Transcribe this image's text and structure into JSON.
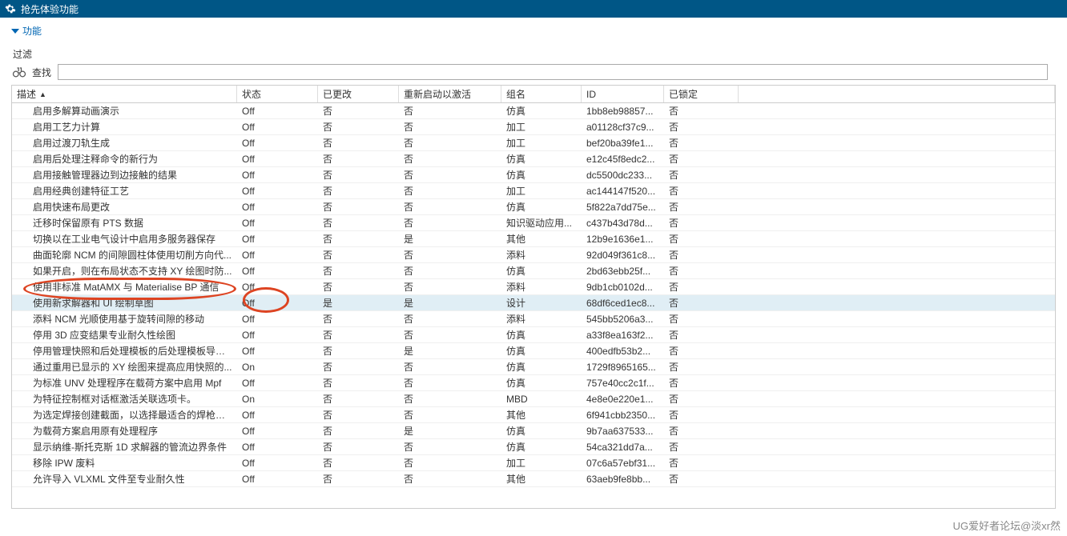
{
  "titlebar": {
    "title": "抢先体验功能"
  },
  "section": {
    "label": "功能"
  },
  "filter": {
    "label": "过滤"
  },
  "search": {
    "label": "查找",
    "value": ""
  },
  "columns": {
    "desc": "描述",
    "state": "状态",
    "changed": "已更改",
    "restart": "重新启动以激活",
    "group": "组名",
    "id": "ID",
    "locked": "已锁定"
  },
  "rows": [
    {
      "desc": "启用多解算动画演示",
      "state": "Off",
      "changed": "否",
      "restart": "否",
      "group": "仿真",
      "id": "1bb8eb98857...",
      "locked": "否",
      "hl": false
    },
    {
      "desc": "启用工艺力计算",
      "state": "Off",
      "changed": "否",
      "restart": "否",
      "group": "加工",
      "id": "a01128cf37c9...",
      "locked": "否",
      "hl": false
    },
    {
      "desc": "启用过渡刀轨生成",
      "state": "Off",
      "changed": "否",
      "restart": "否",
      "group": "加工",
      "id": "bef20ba39fe1...",
      "locked": "否",
      "hl": false
    },
    {
      "desc": "启用后处理注释命令的新行为",
      "state": "Off",
      "changed": "否",
      "restart": "否",
      "group": "仿真",
      "id": "e12c45f8edc2...",
      "locked": "否",
      "hl": false
    },
    {
      "desc": "启用接触管理器边到边接触的结果",
      "state": "Off",
      "changed": "否",
      "restart": "否",
      "group": "仿真",
      "id": "dc5500dc233...",
      "locked": "否",
      "hl": false
    },
    {
      "desc": "启用经典创建特征工艺",
      "state": "Off",
      "changed": "否",
      "restart": "否",
      "group": "加工",
      "id": "ac144147f520...",
      "locked": "否",
      "hl": false
    },
    {
      "desc": "启用快速布局更改",
      "state": "Off",
      "changed": "否",
      "restart": "否",
      "group": "仿真",
      "id": "5f822a7dd75e...",
      "locked": "否",
      "hl": false
    },
    {
      "desc": "迁移时保留原有 PTS 数据",
      "state": "Off",
      "changed": "否",
      "restart": "否",
      "group": "知识驱动应用...",
      "id": "c437b43d78d...",
      "locked": "否",
      "hl": false
    },
    {
      "desc": "切换以在工业电气设计中启用多服务器保存",
      "state": "Off",
      "changed": "否",
      "restart": "是",
      "group": "其他",
      "id": "12b9e1636e1...",
      "locked": "否",
      "hl": false
    },
    {
      "desc": "曲面轮廓 NCM 的间隙圆柱体使用切削方向代...",
      "state": "Off",
      "changed": "否",
      "restart": "否",
      "group": "添料",
      "id": "92d049f361c8...",
      "locked": "否",
      "hl": false
    },
    {
      "desc": "如果开启，则在布局状态不支持 XY 绘图时防...",
      "state": "Off",
      "changed": "否",
      "restart": "否",
      "group": "仿真",
      "id": "2bd63ebb25f...",
      "locked": "否",
      "hl": false
    },
    {
      "desc": "使用非标准 MatAMX 与 Materialise BP 通信",
      "state": "Off",
      "changed": "否",
      "restart": "否",
      "group": "添料",
      "id": "9db1cb0102d...",
      "locked": "否",
      "hl": false
    },
    {
      "desc": "使用新求解器和 UI 绘制草图",
      "state": "Off",
      "changed": "是",
      "restart": "是",
      "group": "设计",
      "id": "68df6ced1ec8...",
      "locked": "否",
      "hl": true
    },
    {
      "desc": "添料 NCM 光顺使用基于旋转间隙的移动",
      "state": "Off",
      "changed": "否",
      "restart": "否",
      "group": "添料",
      "id": "545bb5206a3...",
      "locked": "否",
      "hl": false
    },
    {
      "desc": "停用 3D 应变结果专业耐久性绘图",
      "state": "Off",
      "changed": "否",
      "restart": "否",
      "group": "仿真",
      "id": "a33f8ea163f2...",
      "locked": "否",
      "hl": false
    },
    {
      "desc": "停用管理快照和后处理模板的后处理模板导航器",
      "state": "Off",
      "changed": "否",
      "restart": "是",
      "group": "仿真",
      "id": "400edfb53b2...",
      "locked": "否",
      "hl": false
    },
    {
      "desc": "通过重用已显示的 XY 绘图来提高应用快照的...",
      "state": "On",
      "changed": "否",
      "restart": "否",
      "group": "仿真",
      "id": "1729f8965165...",
      "locked": "否",
      "hl": false
    },
    {
      "desc": "为标准 UNV 处理程序在载荷方案中启用 Mpf",
      "state": "Off",
      "changed": "否",
      "restart": "否",
      "group": "仿真",
      "id": "757e40cc2c1f...",
      "locked": "否",
      "hl": false
    },
    {
      "desc": "为特征控制框对话框激活关联选项卡。",
      "state": "On",
      "changed": "否",
      "restart": "否",
      "group": "MBD",
      "id": "4e8e0e220e1...",
      "locked": "否",
      "hl": false
    },
    {
      "desc": "为选定焊接创建截面，以选择最适合的焊枪并...",
      "state": "Off",
      "changed": "否",
      "restart": "否",
      "group": "其他",
      "id": "6f941cbb2350...",
      "locked": "否",
      "hl": false
    },
    {
      "desc": "为载荷方案启用原有处理程序",
      "state": "Off",
      "changed": "否",
      "restart": "是",
      "group": "仿真",
      "id": "9b7aa637533...",
      "locked": "否",
      "hl": false
    },
    {
      "desc": "显示纳维-斯托克斯 1D 求解器的管流边界条件",
      "state": "Off",
      "changed": "否",
      "restart": "否",
      "group": "仿真",
      "id": "54ca321dd7a...",
      "locked": "否",
      "hl": false
    },
    {
      "desc": "移除 IPW 废料",
      "state": "Off",
      "changed": "否",
      "restart": "否",
      "group": "加工",
      "id": "07c6a57ebf31...",
      "locked": "否",
      "hl": false
    },
    {
      "desc": "允许导入 VLXML 文件至专业耐久性",
      "state": "Off",
      "changed": "否",
      "restart": "否",
      "group": "其他",
      "id": "63aeb9fe8bb...",
      "locked": "否",
      "hl": false
    }
  ],
  "watermark": "UG爱好者论坛@淡xr然"
}
